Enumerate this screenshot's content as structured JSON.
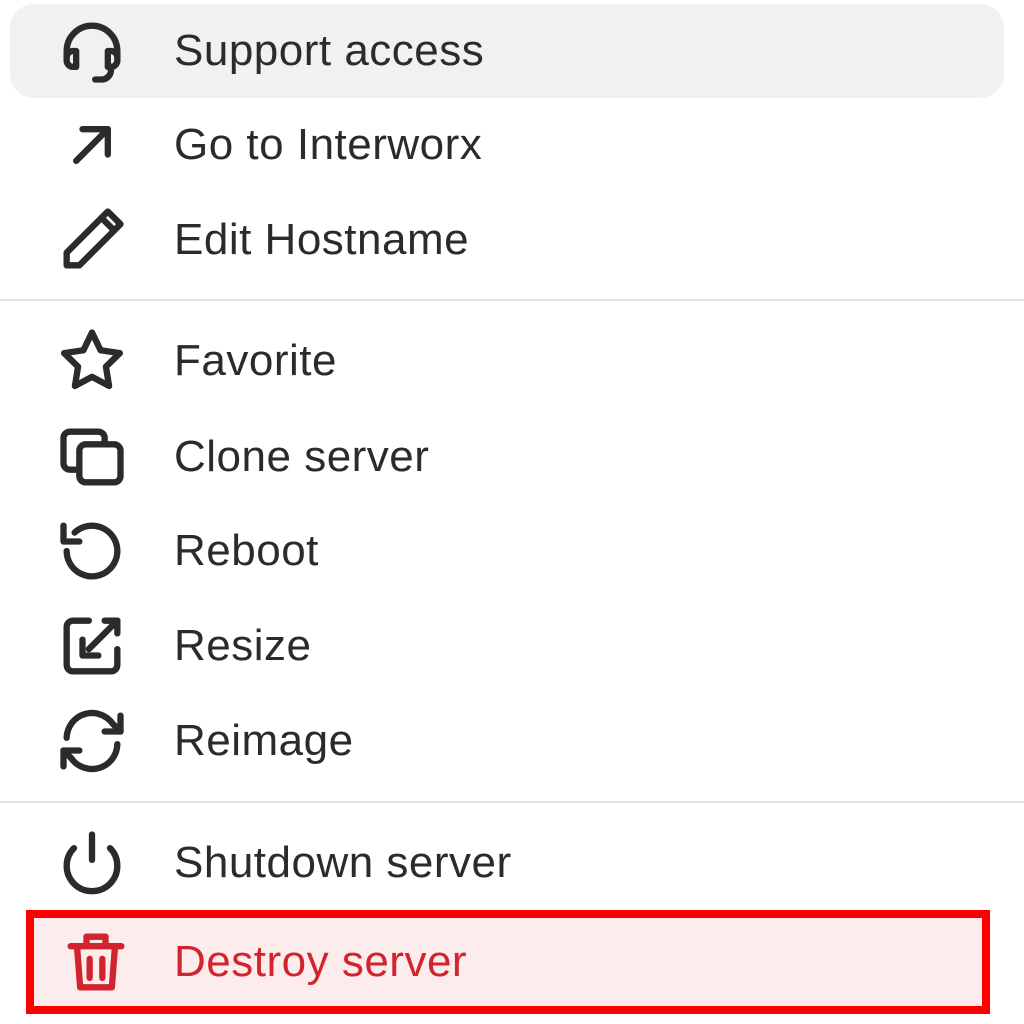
{
  "menu": {
    "items": [
      {
        "label": "Support access",
        "icon": "headset-icon"
      },
      {
        "label": "Go to Interworx",
        "icon": "arrow-up-right-icon"
      },
      {
        "label": "Edit Hostname",
        "icon": "pencil-icon"
      },
      {
        "label": "Favorite",
        "icon": "star-icon"
      },
      {
        "label": "Clone server",
        "icon": "copy-icon"
      },
      {
        "label": "Reboot",
        "icon": "rotate-ccw-icon"
      },
      {
        "label": "Resize",
        "icon": "resize-icon"
      },
      {
        "label": "Reimage",
        "icon": "refresh-icon"
      },
      {
        "label": "Shutdown server",
        "icon": "power-icon"
      },
      {
        "label": "Destroy server",
        "icon": "trash-icon"
      }
    ]
  },
  "colors": {
    "text": "#2b2b2b",
    "danger": "#d1242f",
    "hover_bg": "#f1f1f1",
    "danger_bg": "#fdecec",
    "highlight_border": "#ff0000",
    "divider": "#e4e4e4"
  }
}
